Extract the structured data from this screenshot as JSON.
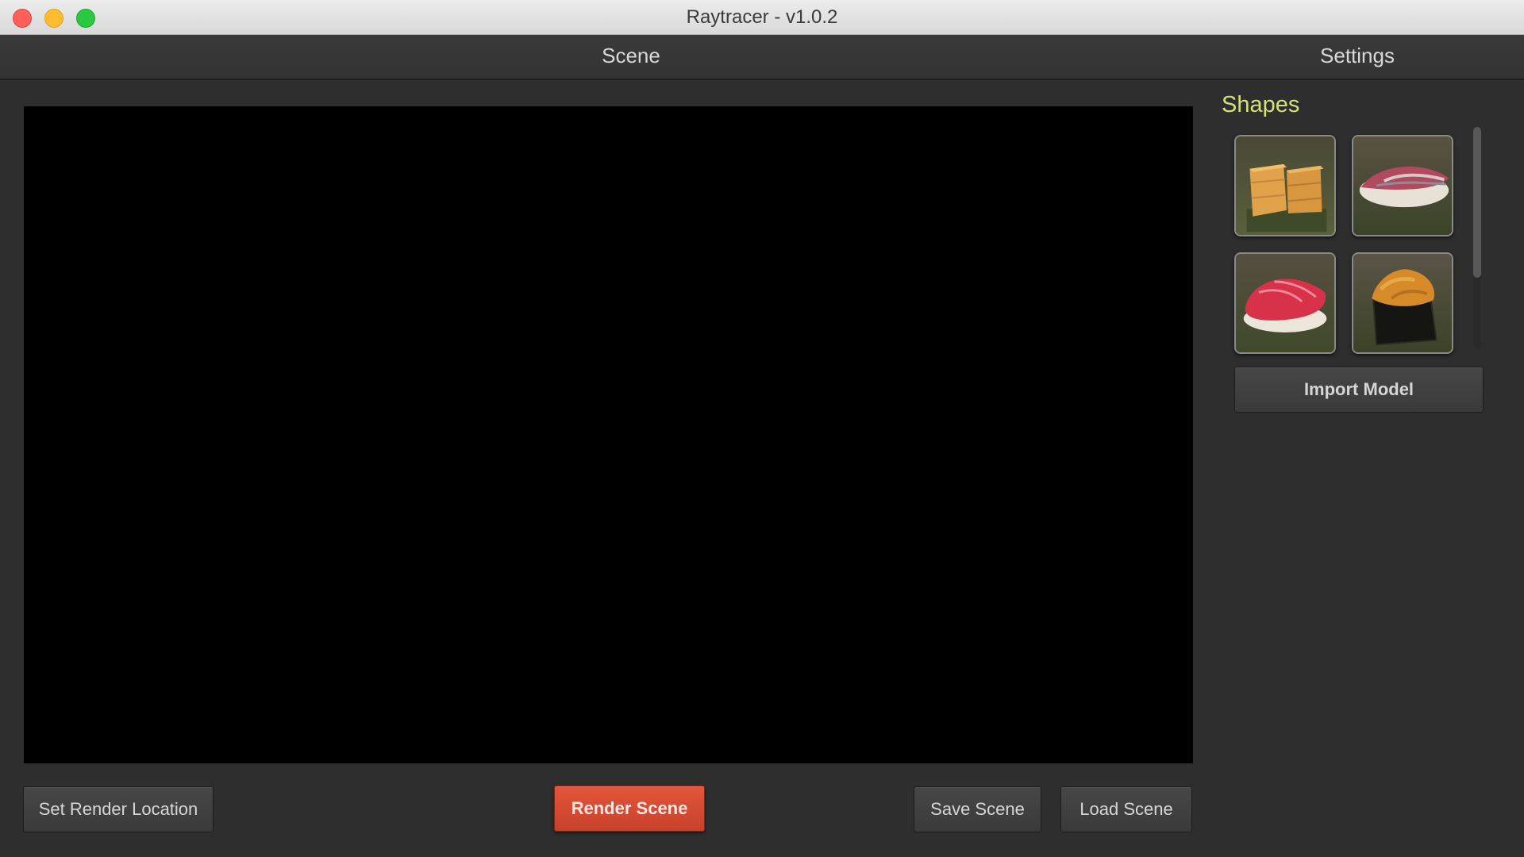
{
  "window": {
    "title": "Raytracer - v1.0.2"
  },
  "tabs": [
    {
      "label": "Scene"
    },
    {
      "label": "Settings"
    }
  ],
  "shapes_panel": {
    "heading": "Shapes",
    "items": [
      {
        "name": "tamago-shape",
        "icon": "tamago-thumbnail"
      },
      {
        "name": "aji-shape",
        "icon": "aji-thumbnail"
      },
      {
        "name": "toro-shape",
        "icon": "toro-thumbnail"
      },
      {
        "name": "uni-shape",
        "icon": "uni-thumbnail"
      }
    ],
    "import_label": "Import Model"
  },
  "footer": {
    "set_render_location_label": "Set Render Location",
    "render_scene_label": "Render Scene",
    "save_scene_label": "Save Scene",
    "load_scene_label": "Load Scene"
  },
  "colors": {
    "accent": "#d6492f",
    "heading": "#d6e07a",
    "background": "#2e2e2e",
    "viewport": "#000000"
  }
}
